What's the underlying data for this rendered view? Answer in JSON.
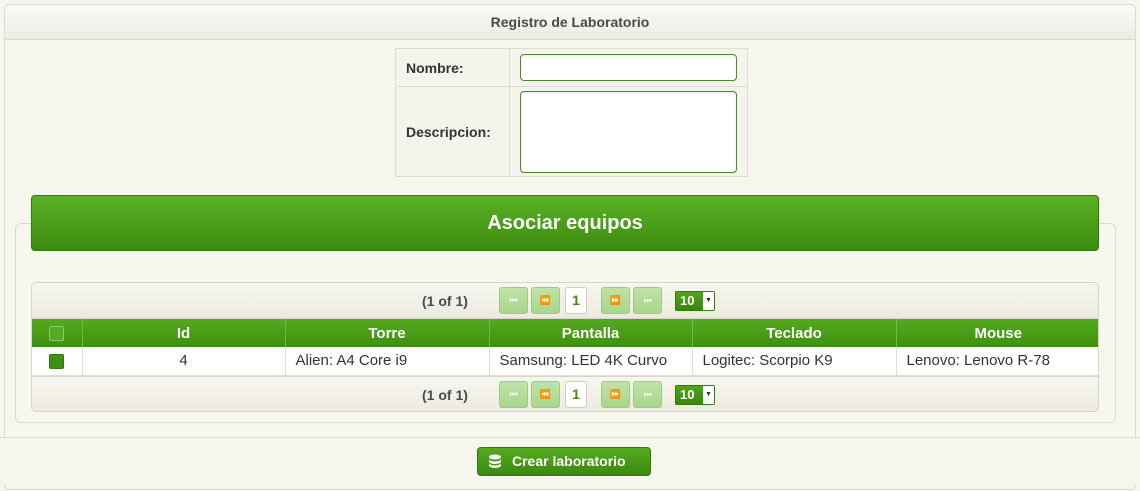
{
  "panel": {
    "title": "Registro de Laboratorio"
  },
  "form": {
    "nombre_label": "Nombre:",
    "nombre_value": "",
    "descripcion_label": "Descripcion:",
    "descripcion_value": ""
  },
  "section": {
    "title": "Asociar equipos"
  },
  "paginator": {
    "current_page_report": "(1 of 1)",
    "page": "1",
    "rows_per_page": "10",
    "first_icon": "first-page-icon",
    "prev_icon": "prev-page-icon",
    "next_icon": "next-page-icon",
    "last_icon": "last-page-icon"
  },
  "table": {
    "columns": [
      "Id",
      "Torre",
      "Pantalla",
      "Teclado",
      "Mouse"
    ],
    "rows": [
      {
        "id": "4",
        "torre": "Alien: A4 Core i9",
        "pantalla": "Samsung: LED 4K Curvo",
        "teclado": "Logitec: Scorpio K9",
        "mouse": "Lenovo: Lenovo R-78",
        "selected": true
      }
    ]
  },
  "footer": {
    "create_label": "Crear laboratorio",
    "create_icon": "database-icon"
  },
  "colors": {
    "accent": "#3f900f",
    "accent_light": "#55ab20",
    "background": "#f6f5ee"
  }
}
